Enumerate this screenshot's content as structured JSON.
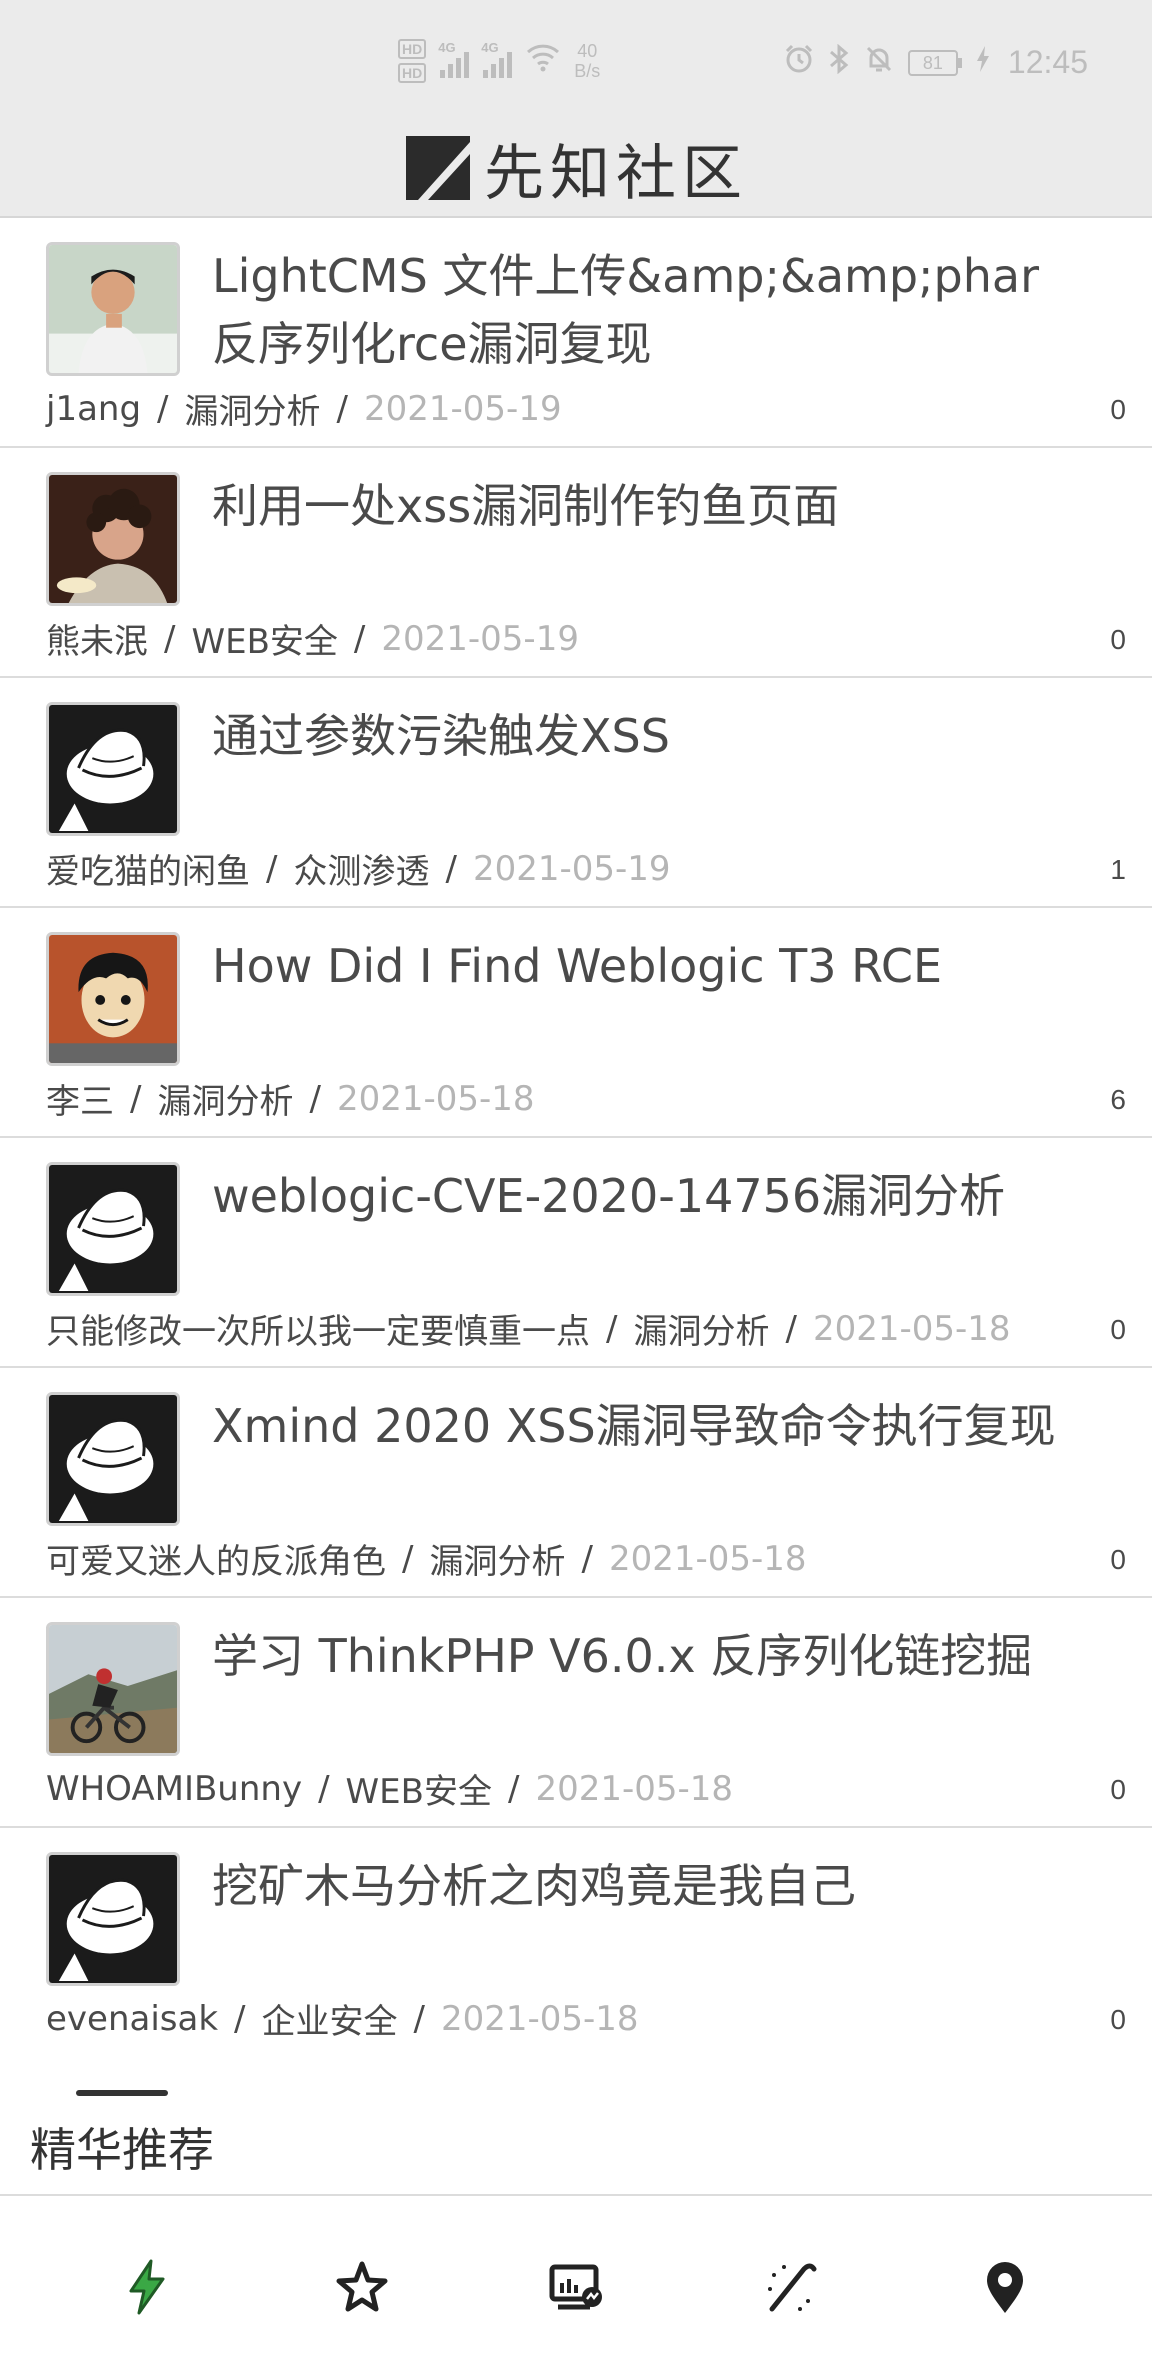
{
  "status_bar": {
    "network_1": "4G",
    "network_2": "4G",
    "speed_value": "40",
    "speed_unit": "B/s",
    "battery": "81",
    "time": "12:45"
  },
  "header": {
    "title": "先知社区"
  },
  "articles": [
    {
      "title": "LightCMS 文件上传&amp;&amp;phar反序列化rce漏洞复现",
      "author": "j1ang",
      "category": "漏洞分析",
      "date": "2021-05-19",
      "comments": "0",
      "avatar": "photo-man-avatar"
    },
    {
      "title": "利用一处xss漏洞制作钓鱼页面",
      "author": "熊未泯",
      "category": "WEB安全",
      "date": "2021-05-19",
      "comments": "0",
      "avatar": "photo-curly-avatar"
    },
    {
      "title": "通过参数污染触发XSS",
      "author": "爱吃猫的闲鱼",
      "category": "众测渗透",
      "date": "2021-05-19",
      "comments": "1",
      "avatar": "default-hat-avatar"
    },
    {
      "title": "How Did I Find Weblogic T3 RCE",
      "author": "李三",
      "category": "漏洞分析",
      "date": "2021-05-18",
      "comments": "6",
      "avatar": "cartoon-boy-avatar"
    },
    {
      "title": "weblogic-CVE-2020-14756漏洞分析",
      "author": "只能修改一次所以我一定要慎重一点",
      "category": "漏洞分析",
      "date": "2021-05-18",
      "comments": "0",
      "avatar": "default-hat-avatar"
    },
    {
      "title": "Xmind 2020 XSS漏洞导致命令执行复现",
      "author": "可爱又迷人的反派角色",
      "category": "漏洞分析",
      "date": "2021-05-18",
      "comments": "0",
      "avatar": "default-hat-avatar"
    },
    {
      "title": "学习 ThinkPHP V6.0.x 反序列化链挖掘",
      "author": "WHOAMIBunny",
      "category": "WEB安全",
      "date": "2021-05-18",
      "comments": "0",
      "avatar": "photo-cyclist-avatar"
    },
    {
      "title": "挖矿木马分析之肉鸡竟是我自己",
      "author": "evenaisak",
      "category": "企业安全",
      "date": "2021-05-18",
      "comments": "0",
      "avatar": "default-hat-avatar"
    }
  ],
  "meta_separator": "/",
  "tab_section": {
    "label": "精华推荐"
  },
  "bottom_nav": [
    {
      "icon": "lightning-icon",
      "active": true
    },
    {
      "icon": "star-icon",
      "active": false
    },
    {
      "icon": "monitor-chart-icon",
      "active": false
    },
    {
      "icon": "magic-wand-icon",
      "active": false
    },
    {
      "icon": "location-pin-icon",
      "active": false
    }
  ],
  "colors": {
    "active_nav": "#3aa845",
    "header_bg": "#ebebeb",
    "date_text": "#b5b5b5"
  }
}
